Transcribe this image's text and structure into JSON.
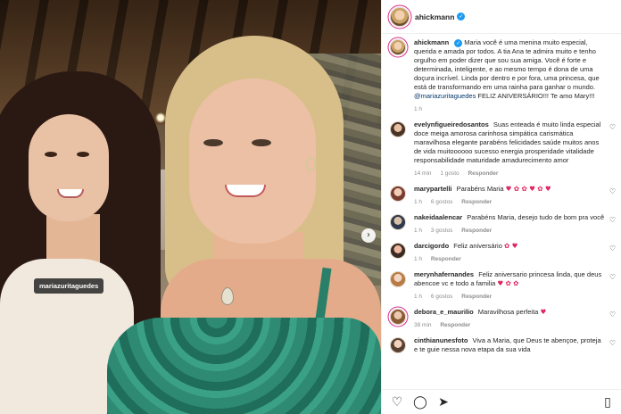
{
  "post": {
    "username": "ahickmann",
    "tagged_user": "mariazuritaguedes"
  },
  "caption": {
    "username": "ahickmann",
    "text": "Maria você é uma menina muito especial, querida e amada por todos. A tia Ana te admira muito e tenho orgulho em poder dizer que sou sua amiga. Você é forte e determinada, inteligente, e ao mesmo tempo é dona de uma doçura incrível. Linda por dentro e por fora, uma princesa, que está de transformando em uma rainha para ganhar o mundo.",
    "mention": "@mariazuritaguedes",
    "text_end": " FELIZ ANIVERSÁRIO!!! Te amo Mary!!!",
    "time": "1 h"
  },
  "comments": [
    {
      "username": "evelynfigueiredosantos",
      "text": "Suas enteada é muito linda especial doce meiga amorosa carinhosa simpática carismática maravilhosa elegante parabéns felicidades saúde muitos anos de vida muitoooooo sucesso energia prosperidade vitalidade responsabilidade maturidade amadurecimento amor",
      "time": "14 min",
      "likes": "1 gosto",
      "reply": "Responder"
    },
    {
      "username": "marypartelli",
      "text": "Parabéns Maria",
      "emoji": "♥ ✿ ✿ ♥ ✿ ♥",
      "time": "1 h",
      "likes": "6 gostos",
      "reply": "Responder"
    },
    {
      "username": "nakeidaalencar",
      "text": "Parabéns Maria, desejo tudo de bom pra você",
      "time": "1 h",
      "likes": "3 gostos",
      "reply": "Responder"
    },
    {
      "username": "darcigordo",
      "text": "Feliz aniversário",
      "emoji": "✿ ♥",
      "time": "1 h",
      "reply": "Responder"
    },
    {
      "username": "merynhafernandes",
      "text": "Feliz aniversario princesa linda, que deus abencoe vc e todo a familia",
      "emoji": "♥ ✿ ✿",
      "time": "1 h",
      "likes": "6 gostos",
      "reply": "Responder"
    },
    {
      "username": "debora_e_maurilio",
      "text": "Maravilhosa perfeita",
      "emoji": "♥",
      "time": "38 min",
      "reply": "Responder"
    },
    {
      "username": "cinthianunesfoto",
      "text": "Viva a Maria, que Deus te abençoe, proteja e te guie nessa nova etapa da sua vida"
    }
  ],
  "icons": {
    "heart": "heart-icon",
    "comment": "comment-icon",
    "share": "share-icon",
    "bookmark": "bookmark-icon",
    "verified": "verified-badge-icon",
    "next": "chevron-right-icon"
  },
  "colors": {
    "link": "#00376b",
    "verified": "#1d9bf0",
    "muted": "#8e8e8e",
    "text": "#262626"
  }
}
